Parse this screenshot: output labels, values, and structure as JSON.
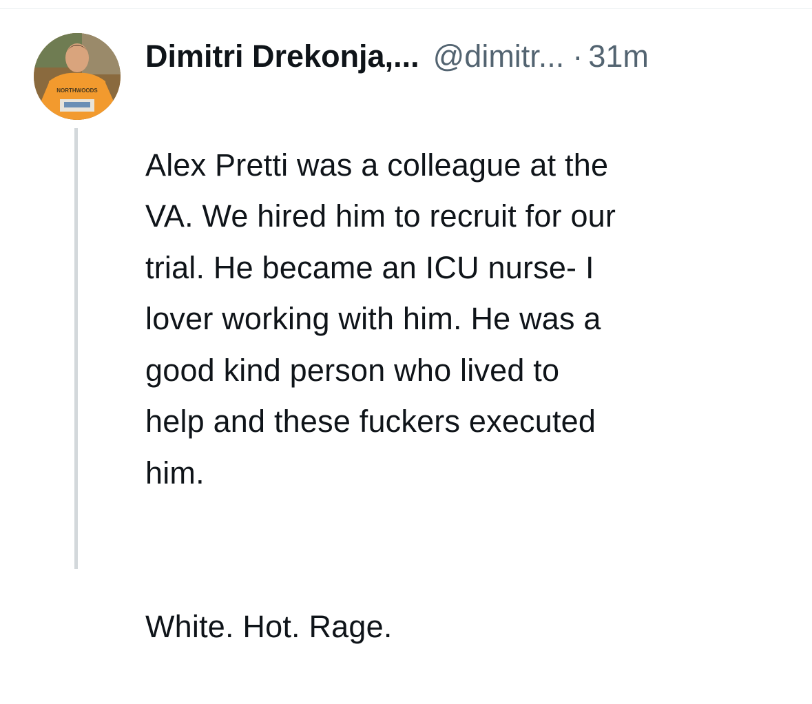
{
  "post": {
    "author": {
      "display_name": "Dimitri Drekonja,...",
      "handle": "@dimitr...",
      "avatar_icon": "profile-photo"
    },
    "separator": "·",
    "timestamp": "31m",
    "paragraphs": [
      "Alex Pretti was a colleague at the\nVA. We hired him to recruit for our\ntrial. He became an ICU nurse- I\nlover working with him. He was a\ngood kind person who lived to\nhelp and these fuckers executed\nhim.",
      "White. Hot. Rage."
    ],
    "avatar_shirt_text": "NORTHWOODS",
    "colors": {
      "text": "#0f1419",
      "secondary": "#536471",
      "thread_line": "#d3d8db",
      "divider": "#eff3f4"
    }
  }
}
